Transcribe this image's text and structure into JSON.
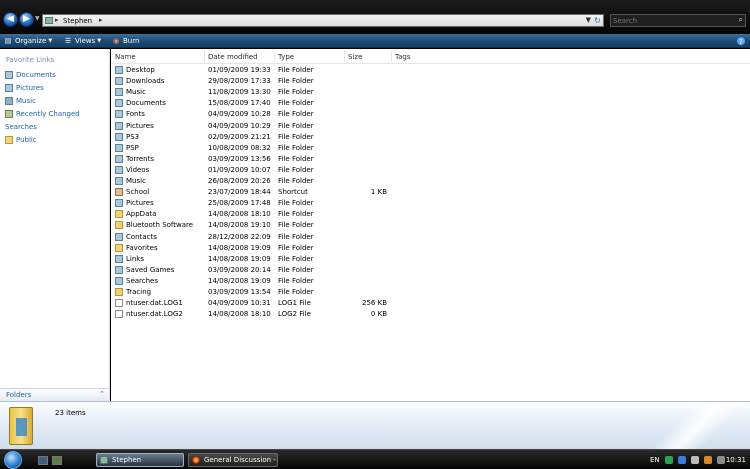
{
  "address": {
    "crumbs": [
      "Stephen"
    ]
  },
  "search": {
    "placeholder": "Search"
  },
  "toolbar": {
    "organize_label": "Organize",
    "views_label": "Views",
    "burn_label": "Burn"
  },
  "nav": {
    "header": "Favorite Links",
    "links": [
      {
        "label": "Documents",
        "icon": "documents-icon"
      },
      {
        "label": "Pictures",
        "icon": "pictures-icon"
      },
      {
        "label": "Music",
        "icon": "music-icon"
      },
      {
        "label": "Recently Changed",
        "icon": "recently-changed-icon"
      },
      {
        "label": "Searches",
        "icon": "searches-icon"
      },
      {
        "label": "Public",
        "icon": "public-icon"
      }
    ],
    "folders_label": "Folders"
  },
  "columns": {
    "name": "Name",
    "date": "Date modified",
    "type": "Type",
    "size": "Size",
    "tags": "Tags"
  },
  "files": [
    {
      "name": "Desktop",
      "date": "01/09/2009 19:33",
      "type": "File Folder",
      "size": "",
      "kind": "special"
    },
    {
      "name": "Downloads",
      "date": "29/08/2009 17:33",
      "type": "File Folder",
      "size": "",
      "kind": "special"
    },
    {
      "name": "Music",
      "date": "11/08/2009 13:30",
      "type": "File Folder",
      "size": "",
      "kind": "special"
    },
    {
      "name": "Documents",
      "date": "15/08/2009 17:40",
      "type": "File Folder",
      "size": "",
      "kind": "special"
    },
    {
      "name": "Fonts",
      "date": "04/09/2009 10:28",
      "type": "File Folder",
      "size": "",
      "kind": "special"
    },
    {
      "name": "Pictures",
      "date": "04/09/2009 10:29",
      "type": "File Folder",
      "size": "",
      "kind": "special"
    },
    {
      "name": "PS3",
      "date": "02/09/2009 21:21",
      "type": "File Folder",
      "size": "",
      "kind": "special"
    },
    {
      "name": "PSP",
      "date": "10/08/2009 08:32",
      "type": "File Folder",
      "size": "",
      "kind": "special"
    },
    {
      "name": "Torrents",
      "date": "03/09/2009 13:56",
      "type": "File Folder",
      "size": "",
      "kind": "special"
    },
    {
      "name": "Videos",
      "date": "01/09/2009 10:07",
      "type": "File Folder",
      "size": "",
      "kind": "special"
    },
    {
      "name": "Music",
      "date": "26/08/2009 20:26",
      "type": "File Folder",
      "size": "",
      "kind": "special"
    },
    {
      "name": "School",
      "date": "23/07/2009 18:44",
      "type": "Shortcut",
      "size": "1 KB",
      "kind": "shortcut"
    },
    {
      "name": "Pictures",
      "date": "25/08/2009 17:48",
      "type": "File Folder",
      "size": "",
      "kind": "special"
    },
    {
      "name": "AppData",
      "date": "14/08/2008 18:10",
      "type": "File Folder",
      "size": "",
      "kind": "folder"
    },
    {
      "name": "Bluetooth Software",
      "date": "14/08/2008 19:10",
      "type": "File Folder",
      "size": "",
      "kind": "folder"
    },
    {
      "name": "Contacts",
      "date": "28/12/2008 22:09",
      "type": "File Folder",
      "size": "",
      "kind": "special"
    },
    {
      "name": "Favorites",
      "date": "14/08/2008 19:09",
      "type": "File Folder",
      "size": "",
      "kind": "folder"
    },
    {
      "name": "Links",
      "date": "14/08/2008 19:09",
      "type": "File Folder",
      "size": "",
      "kind": "special"
    },
    {
      "name": "Saved Games",
      "date": "03/09/2008 20:14",
      "type": "File Folder",
      "size": "",
      "kind": "special"
    },
    {
      "name": "Searches",
      "date": "14/08/2008 19:09",
      "type": "File Folder",
      "size": "",
      "kind": "special"
    },
    {
      "name": "Tracing",
      "date": "03/09/2009 13:54",
      "type": "File Folder",
      "size": "",
      "kind": "folder"
    },
    {
      "name": "ntuser.dat.LOG1",
      "date": "04/09/2009 10:31",
      "type": "LOG1 File",
      "size": "256 KB",
      "kind": "file"
    },
    {
      "name": "ntuser.dat.LOG2",
      "date": "14/08/2008 18:10",
      "type": "LOG2 File",
      "size": "0 KB",
      "kind": "file"
    }
  ],
  "details": {
    "count": "23 items"
  },
  "taskbar": {
    "buttons": [
      {
        "label": "Stephen"
      },
      {
        "label": "General Discussion - ..."
      }
    ],
    "language": "EN",
    "clock": "10:31"
  },
  "colors": {
    "accent": "#1f5fa8",
    "command_bar": "#1d4b73",
    "taskbar": "#050505"
  }
}
